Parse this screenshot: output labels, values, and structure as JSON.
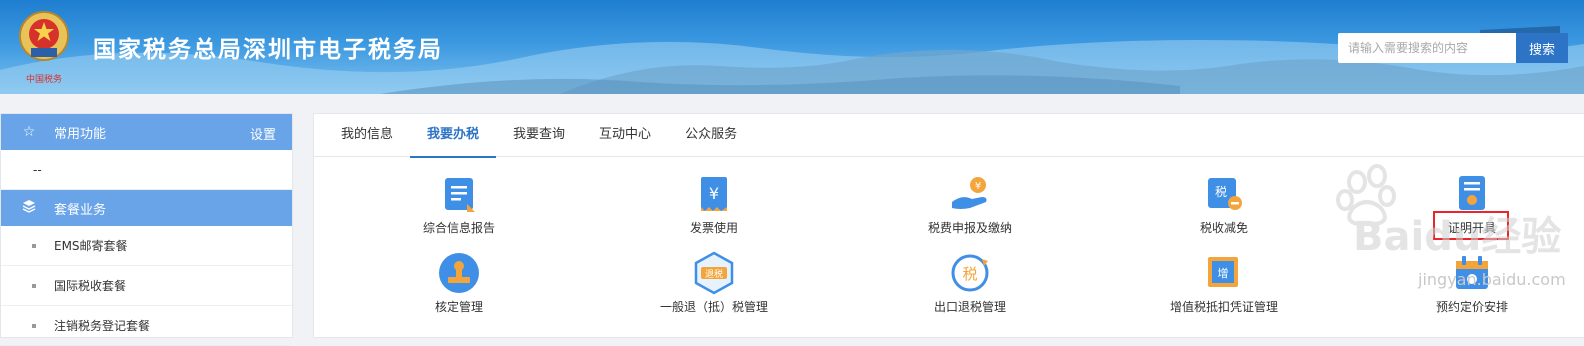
{
  "header": {
    "title": "国家税务总局深圳市电子税务局",
    "emblem_caption": "中国税务",
    "search_placeholder": "请输入需要搜索的内容",
    "search_button": "搜索"
  },
  "sidebar": {
    "favorites": {
      "label": "常用功能",
      "setting": "设置",
      "icon": "star-icon",
      "empty": "--"
    },
    "packages": {
      "label": "套餐业务",
      "icon": "layers-icon",
      "items": [
        "EMS邮寄套餐",
        "国际税收套餐",
        "注销税务登记套餐"
      ]
    }
  },
  "tabs": [
    "我的信息",
    "我要办税",
    "我要查询",
    "互动中心",
    "公众服务"
  ],
  "active_tab": "我要办税",
  "services": [
    {
      "label": "综合信息报告",
      "icon": "report-icon"
    },
    {
      "label": "发票使用",
      "icon": "invoice-icon"
    },
    {
      "label": "税费申报及缴纳",
      "icon": "payment-icon"
    },
    {
      "label": "税收减免",
      "icon": "tax-reduction-icon"
    },
    {
      "label": "证明开具",
      "icon": "certificate-icon"
    },
    {
      "label": "核定管理",
      "icon": "stamp-icon"
    },
    {
      "label": "一般退（抵）税管理",
      "icon": "refund-icon"
    },
    {
      "label": "出口退税管理",
      "icon": "export-refund-icon"
    },
    {
      "label": "增值税抵扣凭证管理",
      "icon": "vat-voucher-icon"
    },
    {
      "label": "预约定价安排",
      "icon": "calendar-icon"
    }
  ],
  "highlight": "证明开具",
  "watermark": {
    "brand": "Baidu经验",
    "url": "jingyan.baidu.com"
  },
  "colors": {
    "primary": "#2d74c7",
    "sidebar_header": "#69a4e8",
    "highlight_border": "#e8262b"
  }
}
